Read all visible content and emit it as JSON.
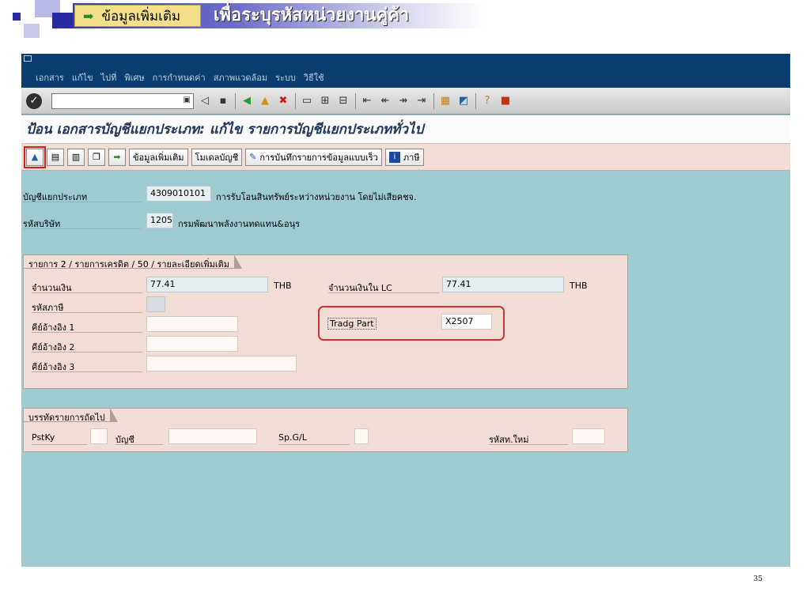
{
  "slide": {
    "callout_label": "ข้อมูลเพิ่มเติม",
    "title": "เพื่อระบุรหัสหน่วยงานคู่ค้า",
    "page_number": "35"
  },
  "menu": {
    "items": [
      "เอกสาร",
      "แก้ไข",
      "ไปที่",
      "พิเศษ",
      "การกำหนดค่า",
      "สภาพแวดล้อม",
      "ระบบ",
      "วิธีใช้"
    ]
  },
  "screen_title": "ป้อน เอกสารบัญชีแยกประเภท: แก้ไข รายการบัญชีแยกประเภททั่วไป",
  "appbar": {
    "more_data_label": "ข้อมูลเพิ่มเติม",
    "model_account_label": "โมเดลบัญชี",
    "fast_entry_label": "การบันทึกรายการข้อมูลแบบเร็ว",
    "tax_label": "ภาษี"
  },
  "header_fields": {
    "gl_account_label": "บัญชีแยกประเภท",
    "gl_account_value": "4309010101",
    "gl_account_desc": "การรับโอนสินทรัพย์ระหว่างหน่วยงาน โดยไม่เสียคชจ.",
    "company_code_label": "รหัสบริษัท",
    "company_code_value": "1205",
    "company_code_desc": "กรมพัฒนาพลังงานทดแทน&อนุร"
  },
  "item_group": {
    "tab": "รายการ 2 / รายการเครดิต / 50 / รายละเอียดเพิ่มเติม",
    "amount_label": "จำนวนเงิน",
    "amount_value": "77.41",
    "amount_currency": "THB",
    "amount_lc_label": "จำนวนเงินใน LC",
    "amount_lc_value": "77.41",
    "amount_lc_currency": "THB",
    "tax_code_label": "รหัสภาษี",
    "ref_key1_label": "คีย์อ้างอิง 1",
    "ref_key2_label": "คีย์อ้างอิง 2",
    "ref_key3_label": "คีย์อ้างอิง 3",
    "trading_partner_label": "Tradg Part",
    "trading_partner_value": "X2507"
  },
  "next_item_group": {
    "tab": "บรรทัดรายการถัดไป",
    "pstky_label": "PstKy",
    "account_label": "บัญชี",
    "spgl_label": "Sp.G/L",
    "new_cocode_label": "รหัสท.ใหม่"
  },
  "colors": {
    "menubar": "#0b3d6e",
    "screen_bg": "#9ecbd0",
    "appbar": "#f2ddd6",
    "highlight": "#d83030"
  }
}
